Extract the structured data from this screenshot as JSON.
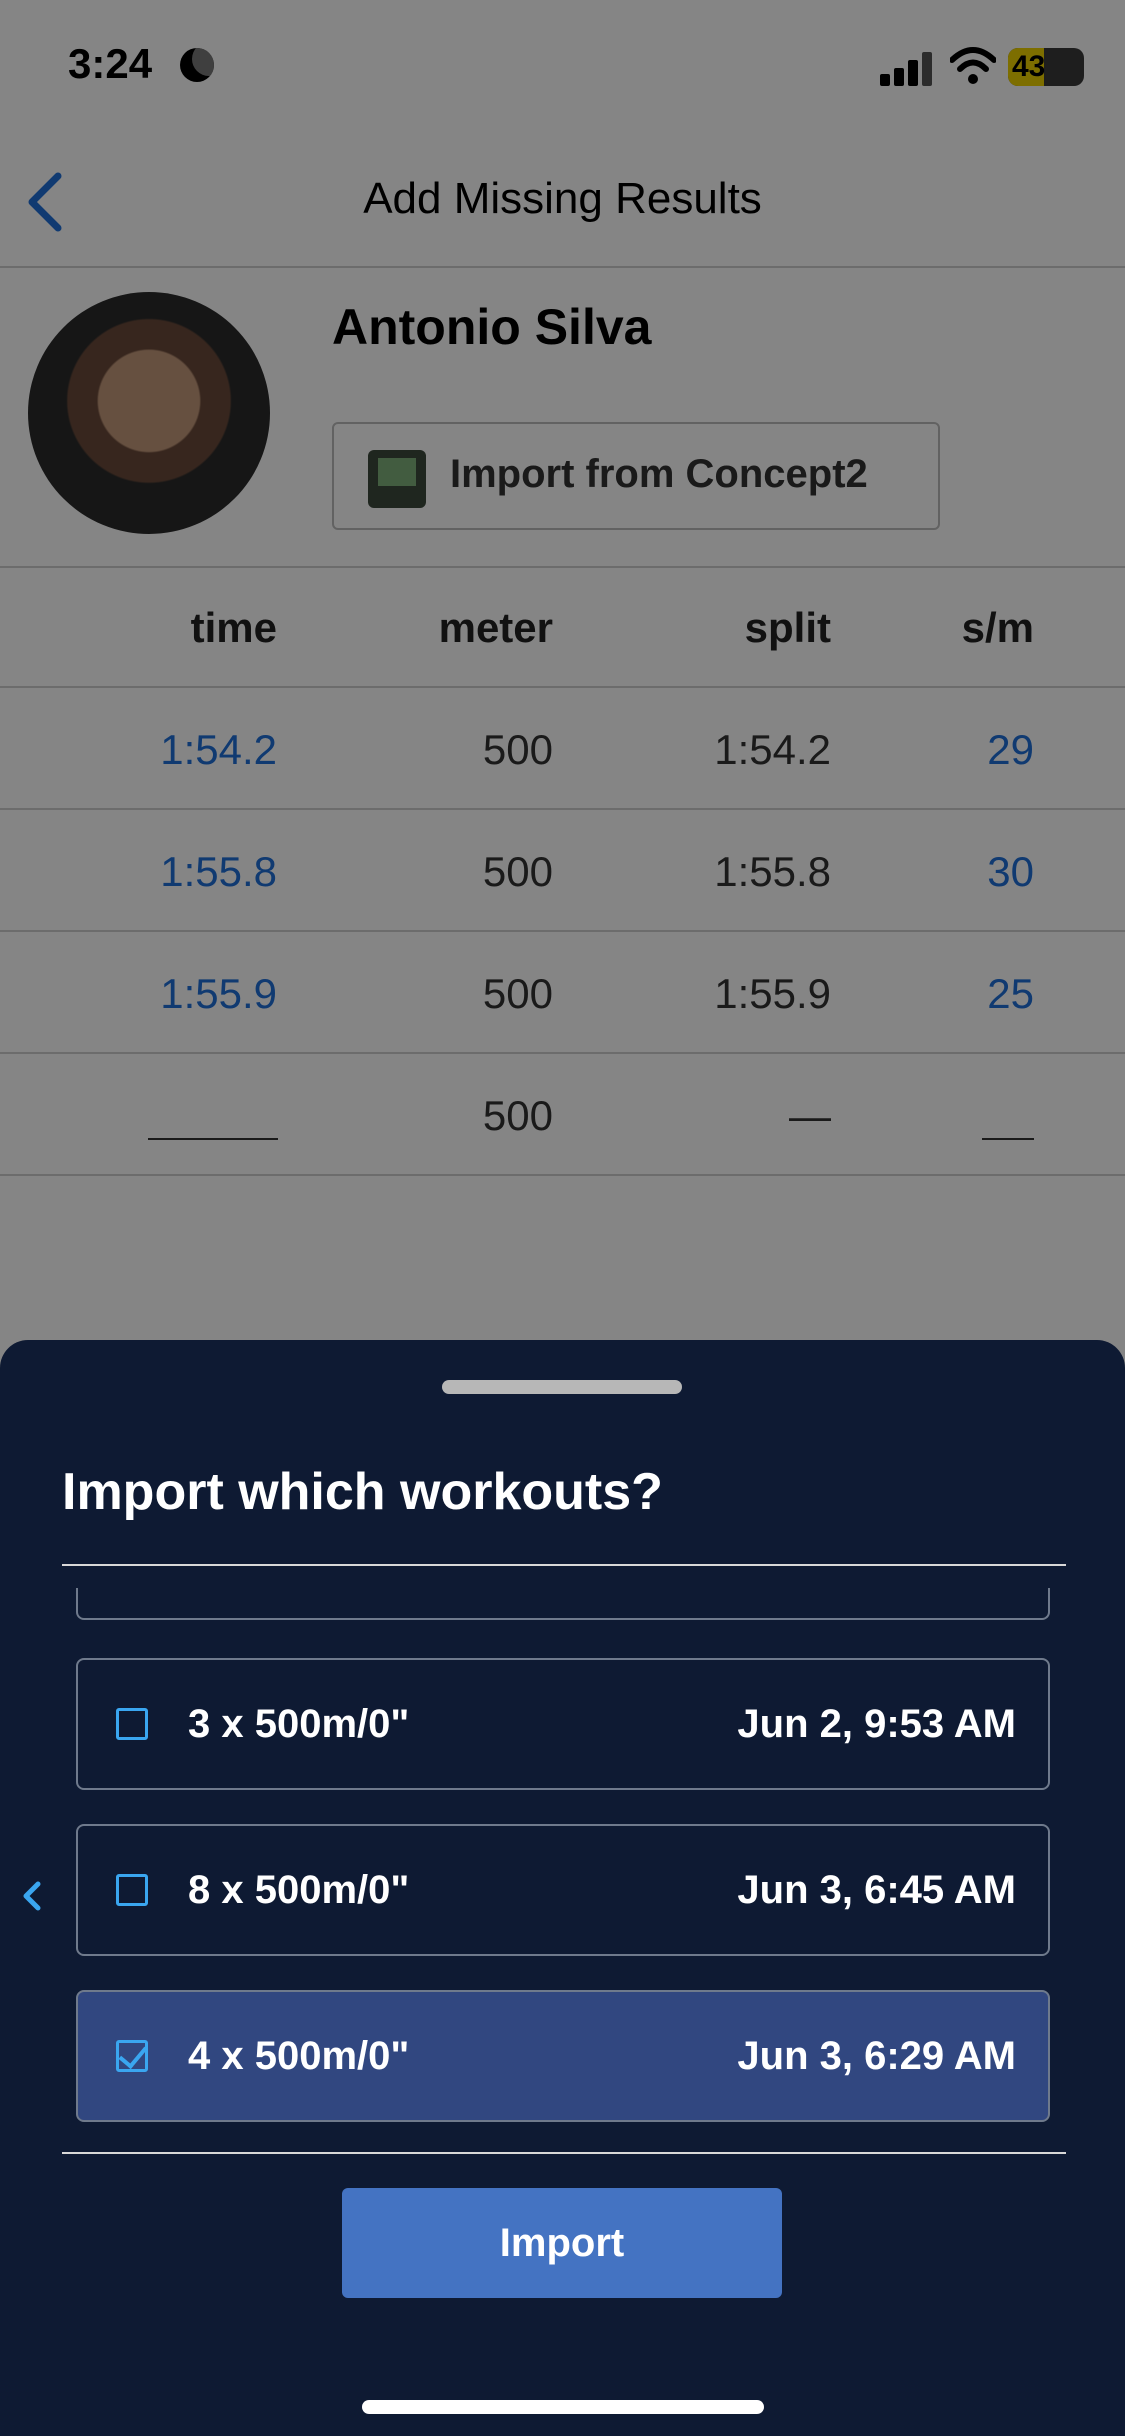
{
  "status_bar": {
    "time": "3:24",
    "battery": "43"
  },
  "nav": {
    "title": "Add Missing Results"
  },
  "athlete": {
    "name": "Antonio Silva",
    "import_button": "Import from Concept2"
  },
  "results_table": {
    "headers": [
      "time",
      "meter",
      "split",
      "s/m"
    ],
    "rows": [
      {
        "time": "1:54.2",
        "meter": "500",
        "split": "1:54.2",
        "spm": "29"
      },
      {
        "time": "1:55.8",
        "meter": "500",
        "split": "1:55.8",
        "spm": "30"
      },
      {
        "time": "1:55.9",
        "meter": "500",
        "split": "1:55.9",
        "spm": "25"
      },
      {
        "time": "",
        "meter": "500",
        "split": "—",
        "spm": ""
      }
    ]
  },
  "sheet": {
    "title": "Import which workouts?",
    "workouts": [
      {
        "name": "3 x 500m/0\"",
        "date": "Jun 2, 9:53 AM",
        "checked": false
      },
      {
        "name": "8 x 500m/0\"",
        "date": "Jun 3, 6:45 AM",
        "checked": false
      },
      {
        "name": "4 x 500m/0\"",
        "date": "Jun 3, 6:29 AM",
        "checked": true
      }
    ],
    "import_button": "Import"
  },
  "colors": {
    "sheet_bg": "#0e1a33",
    "selected_bg": "#314780",
    "accent": "#3aa6f0",
    "button": "#4473c2",
    "link_blue": "#1f6fd9"
  }
}
